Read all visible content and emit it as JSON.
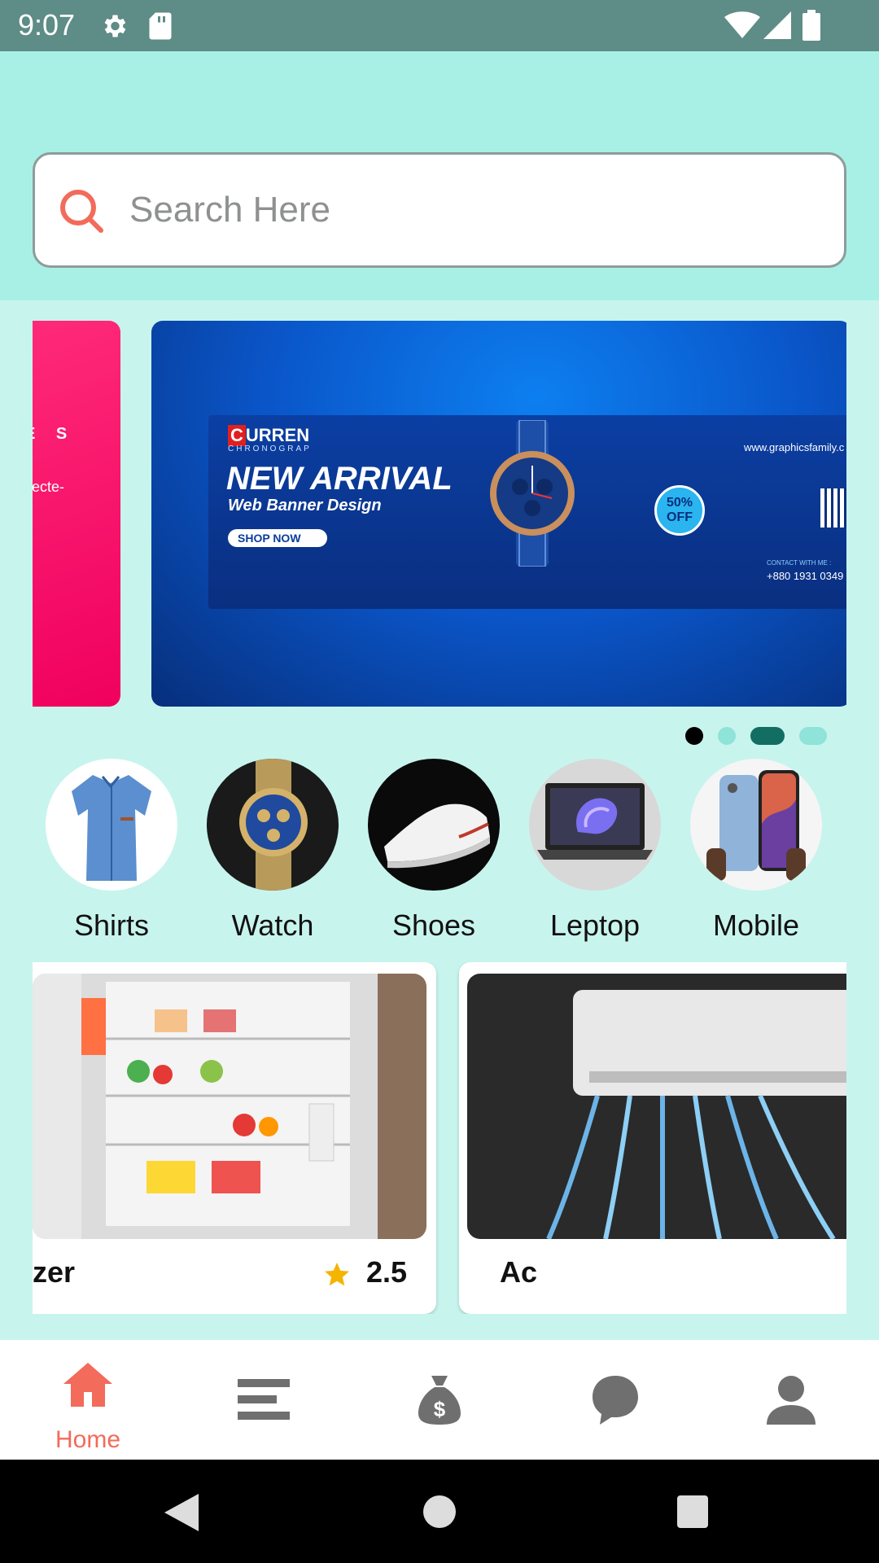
{
  "status_bar": {
    "time": "9:07"
  },
  "search": {
    "placeholder": "Search Here",
    "value": ""
  },
  "banners": {
    "pink": {
      "text_top": "E S",
      "text_sub": "secte-"
    },
    "blue": {
      "brand": "URREN",
      "brand_initial": "C",
      "brand_sub": "CHRONOGRAP",
      "headline": "NEW ARRIVAL",
      "subheadline": "Web Banner Design",
      "cta": "SHOP NOW",
      "discount_top": "50%",
      "discount_bottom": "OFF",
      "url": "www.graphicsfamily.c",
      "contact_label": "CONTACT WITH ME :",
      "contact_phone": "+880 1931 0349"
    },
    "active_index": 0,
    "dot_count": 4
  },
  "categories": [
    {
      "label": "Shirts",
      "icon": "shirt-image"
    },
    {
      "label": "Watch",
      "icon": "watch-image"
    },
    {
      "label": "Shoes",
      "icon": "shoe-image"
    },
    {
      "label": "Leptop",
      "icon": "laptop-image"
    },
    {
      "label": "Mobile",
      "icon": "mobile-image"
    }
  ],
  "products": [
    {
      "name": "zer",
      "rating": "2.5",
      "icon": "fridge-image"
    },
    {
      "name": "Ac",
      "rating": "",
      "icon": "air-conditioner-image"
    }
  ],
  "bottom_nav": {
    "items": [
      {
        "label": "Home",
        "icon": "home-icon",
        "active": true
      },
      {
        "label": "",
        "icon": "menu-icon",
        "active": false
      },
      {
        "label": "",
        "icon": "money-bag-icon",
        "active": false
      },
      {
        "label": "",
        "icon": "chat-icon",
        "active": false
      },
      {
        "label": "",
        "icon": "profile-icon",
        "active": false
      }
    ]
  },
  "colors": {
    "accent": "#f26b5b",
    "header_bg": "#a8f0e6",
    "page_bg": "#c8f4ee",
    "status_bar": "#5e8c86",
    "dot_active": "#000000",
    "dot_dark": "#136e62",
    "dot_light": "#8fe3d8",
    "nav_icon_inactive": "#6f6f6f"
  }
}
